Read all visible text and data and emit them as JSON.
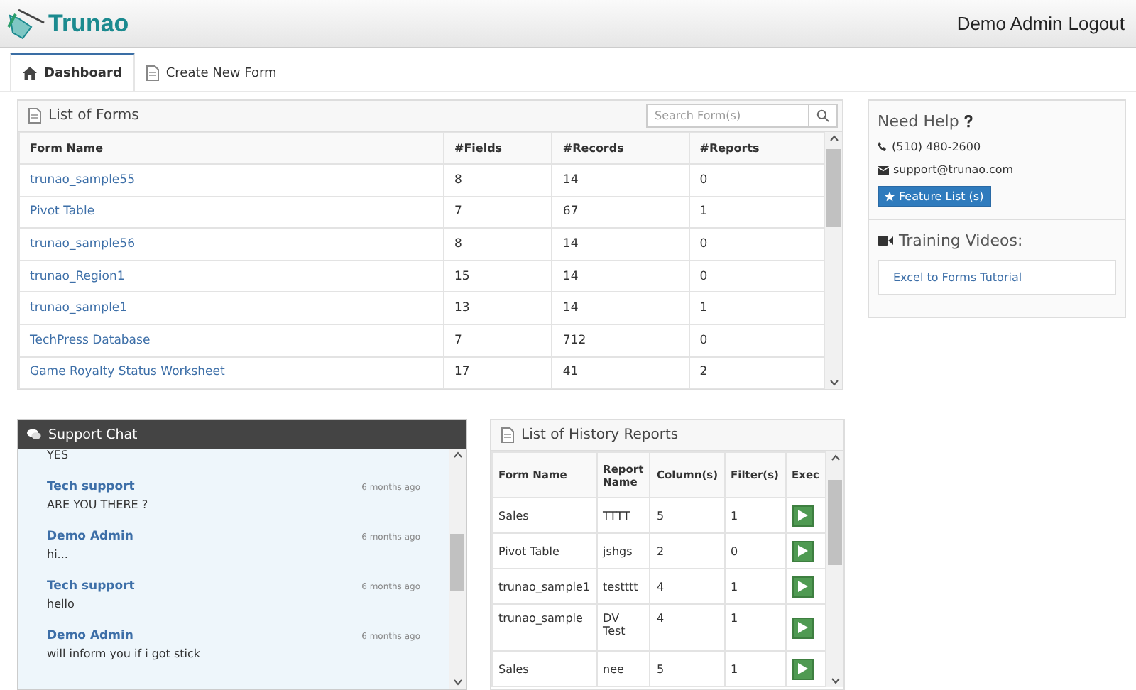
{
  "header": {
    "logo": "Trunao",
    "user": "Demo Admin",
    "logout": "Logout"
  },
  "tabs": [
    {
      "label": "Dashboard",
      "selected": true
    },
    {
      "label": "Create New Form",
      "selected": false
    }
  ],
  "forms": {
    "title": "List of Forms",
    "search": {
      "placeholder": "Search Form(s)"
    },
    "columns": [
      "Form Name",
      "#Fields",
      "#Records",
      "#Reports"
    ],
    "rows": [
      [
        "trunao_sample55",
        "8",
        "14",
        "0"
      ],
      [
        "Pivot Table",
        "7",
        "67",
        "1"
      ],
      [
        "trunao_sample56",
        "8",
        "14",
        "0"
      ],
      [
        "trunao_Region1",
        "15",
        "14",
        "0"
      ],
      [
        "trunao_sample1",
        "13",
        "14",
        "1"
      ],
      [
        "TechPress Database",
        "7",
        "712",
        "0"
      ],
      [
        "Game Royalty Status Worksheet",
        "17",
        "41",
        "2"
      ]
    ]
  },
  "help": {
    "title": "Need Help",
    "phone": "(510) 480-2600",
    "email": "support@trunao.com",
    "feature_button": "Feature List (s)",
    "videos_title": "Training Videos:",
    "videos": [
      "Excel to Forms Tutorial"
    ]
  },
  "chat": {
    "title": "Support Chat",
    "messages": [
      {
        "text": "YES"
      },
      {
        "author": "Tech support",
        "time": "6 months ago",
        "text": "ARE YOU THERE ?"
      },
      {
        "author": "Demo Admin",
        "time": "6 months ago",
        "text": "hi..."
      },
      {
        "author": "Tech support",
        "time": "6 months ago",
        "text": "hello"
      },
      {
        "author": "Demo Admin",
        "time": "6 months ago",
        "text": "will inform you if i got stick"
      }
    ]
  },
  "history": {
    "title": "List of History Reports",
    "columns": [
      "Form Name",
      "Report Name",
      "Column(s)",
      "Filter(s)",
      "Exec"
    ],
    "rows": [
      [
        "Sales",
        "TTTT",
        "5",
        "1"
      ],
      [
        "Pivot Table",
        "jshgs",
        "2",
        "0"
      ],
      [
        "trunao_sample1",
        "testttt",
        "4",
        "1"
      ],
      [
        "trunao_sample",
        "DV Test",
        "4",
        "1"
      ],
      [
        "Sales",
        "nee",
        "5",
        "1"
      ]
    ]
  }
}
